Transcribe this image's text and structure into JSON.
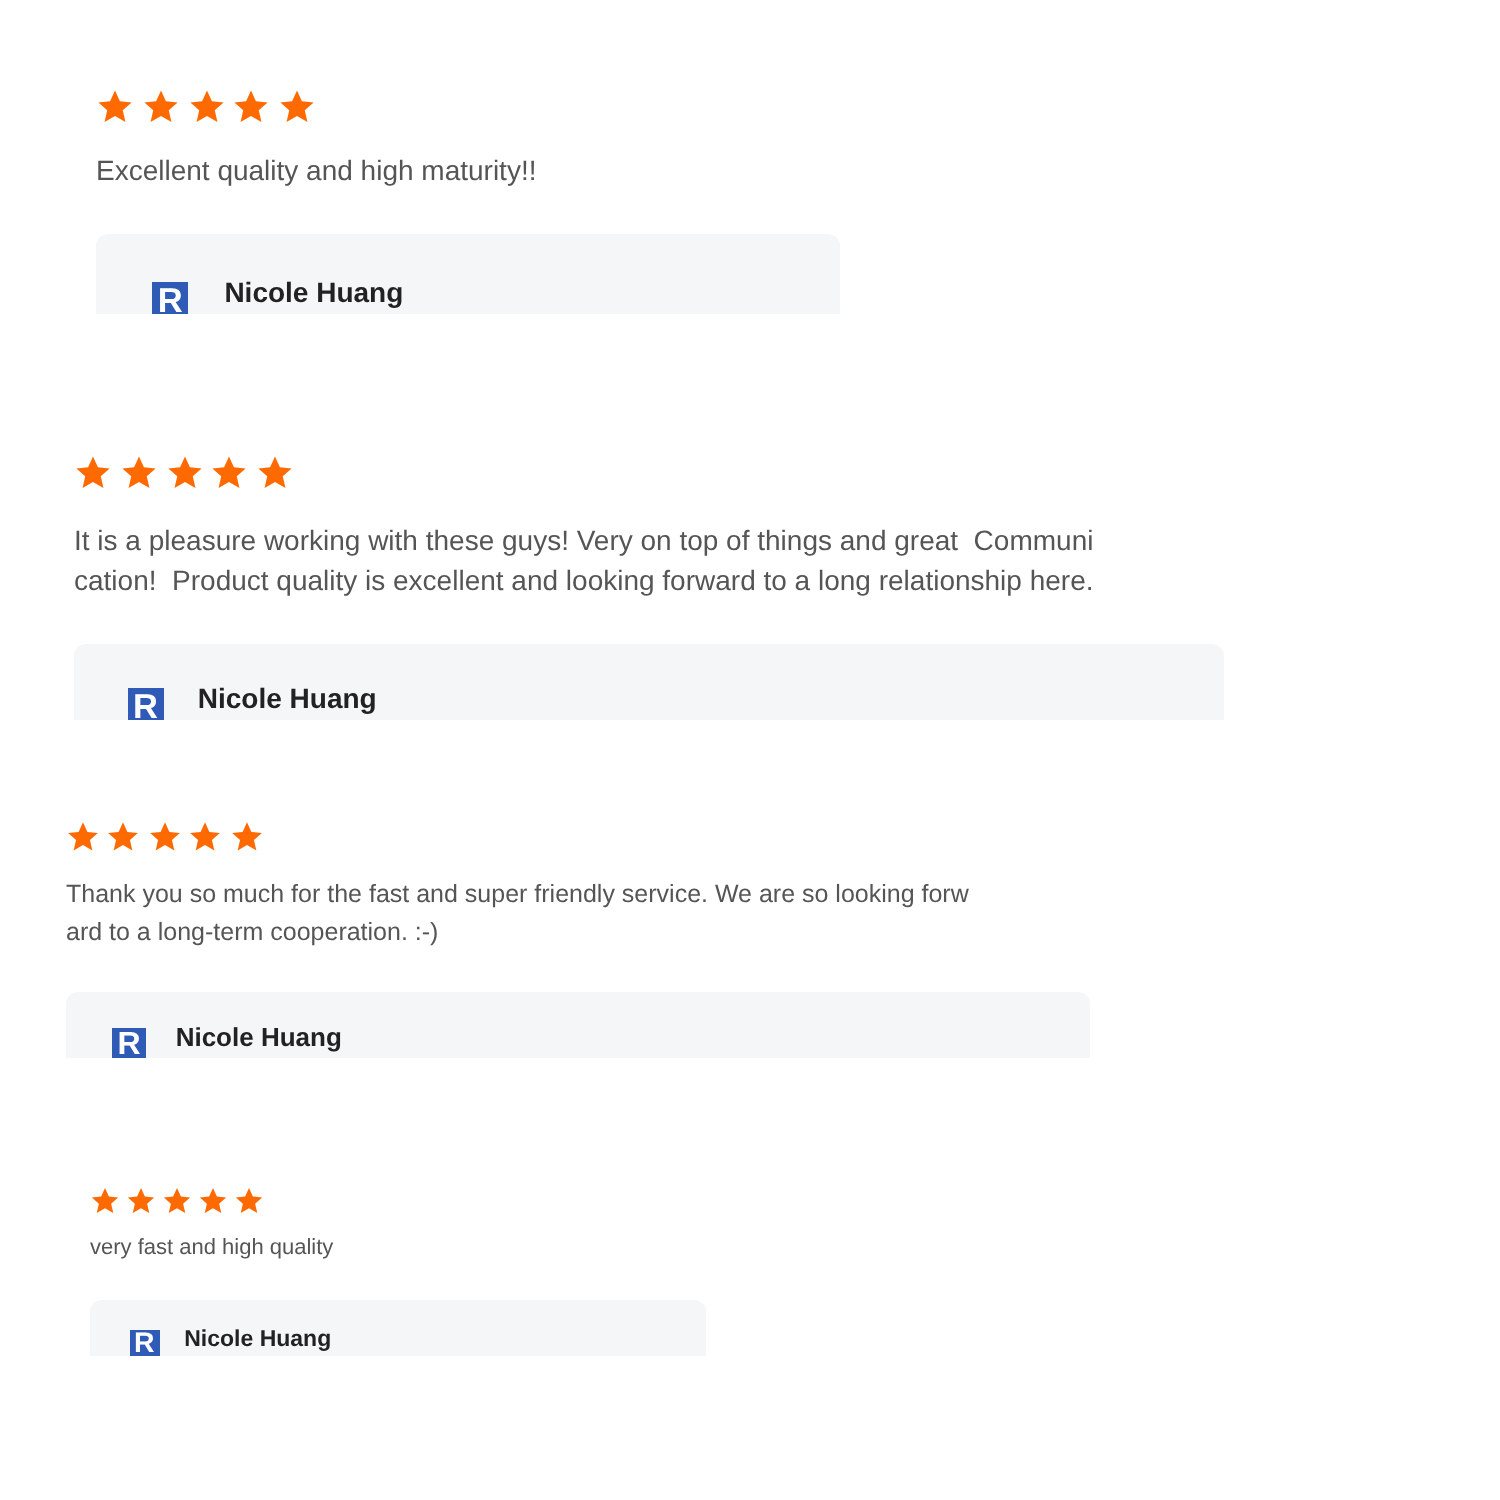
{
  "reviews": [
    {
      "stars": 5,
      "text_lines": [
        "Excellent quality and high maturity!!"
      ],
      "author": {
        "logo": "R",
        "name": "Nicole Huang"
      }
    },
    {
      "stars": 5,
      "text_lines": [
        "It is a pleasure working with these guys! Very on top of things and great  Communi",
        "cation!  Product quality is excellent and looking forward to a long relationship here."
      ],
      "author": {
        "logo": "R",
        "name": "Nicole Huang"
      }
    },
    {
      "stars": 5,
      "text_lines": [
        "Thank you so much for the fast and super friendly service. We are so looking forw",
        "ard to a long-term cooperation. :-)"
      ],
      "author": {
        "logo": "R",
        "name": "Nicole Huang"
      }
    },
    {
      "stars": 5,
      "text_lines": [
        "very fast and high quality"
      ],
      "author": {
        "logo": "R",
        "name": "Nicole Huang"
      }
    }
  ]
}
